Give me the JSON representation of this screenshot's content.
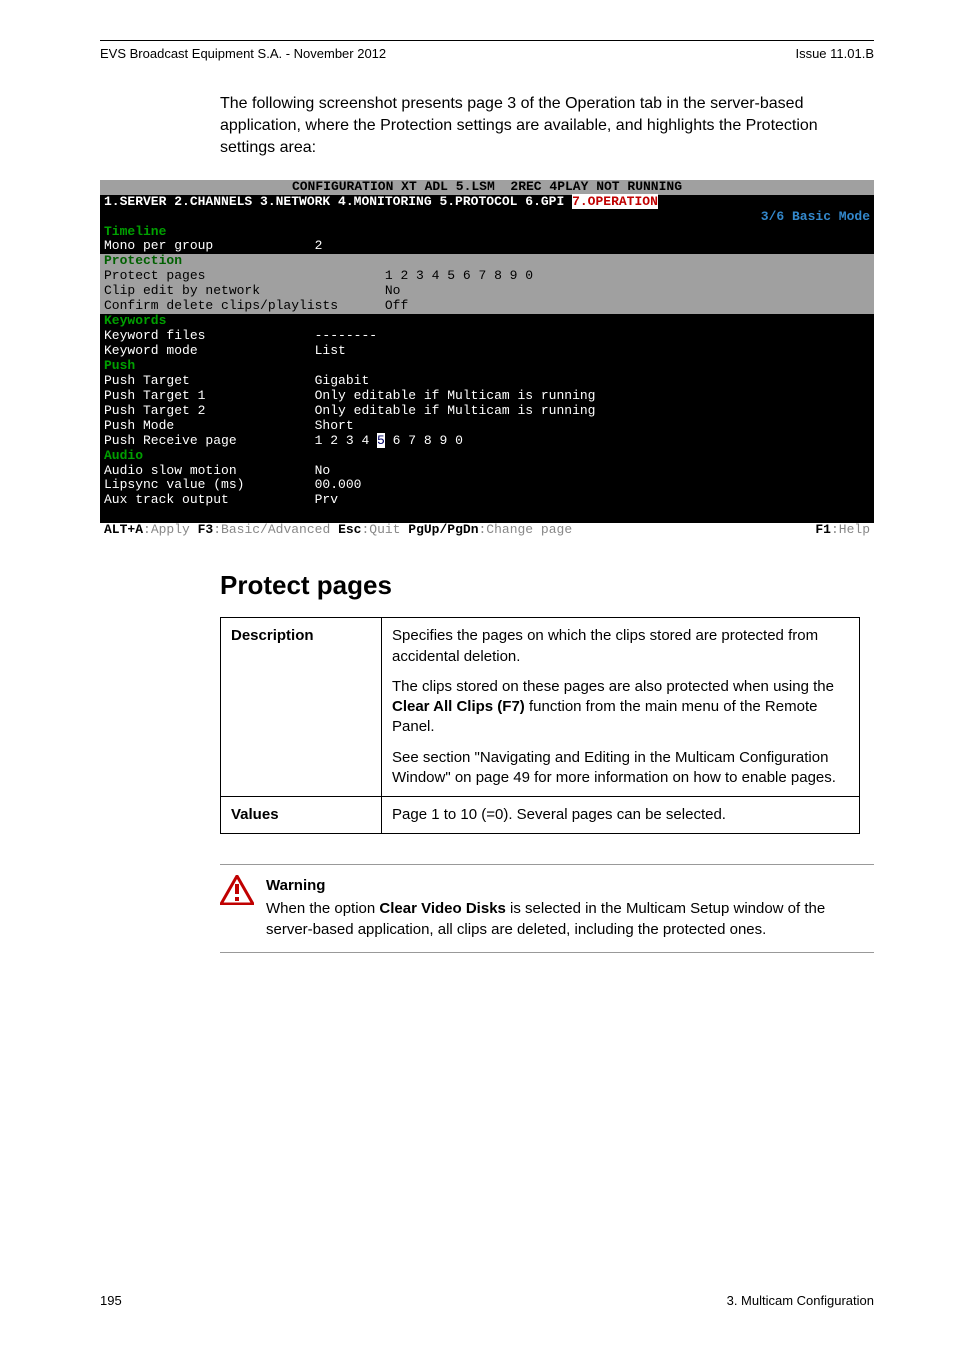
{
  "header": {
    "left": "EVS Broadcast Equipment S.A. - November 2012",
    "right": "Issue 11.01.B"
  },
  "intro": "The following screenshot presents page 3 of the Operation tab in the server-based application, where the Protection settings are available, and highlights the Protection settings area:",
  "terminal": {
    "title": "CONFIGURATION XT ADL 5.LSM  2REC 4PLAY NOT RUNNING",
    "tabs": "1.SERVER 2.CHANNELS 3.NETWORK 4.MONITORING 5.PROTOCOL 6.GPI ",
    "tabs_active": "7.OPERATION",
    "mode": "3/6 Basic Mode",
    "lines": {
      "timeline_h": "Timeline",
      "mono": "Mono per group             2",
      "protection_h": "Protection",
      "protect": "Protect pages                       1 2 3 4 5 6 7 8 9 0",
      "clipedit": "Clip edit by network                No",
      "confirm": "Confirm delete clips/playlists      Off",
      "keywords_h": "Keywords",
      "kfiles": "Keyword files              --------",
      "kmode": "Keyword mode               List",
      "push_h": "Push",
      "ptarget": "Push Target                Gigabit",
      "pt1": "Push Target 1              Only editable if Multicam is running",
      "pt2": "Push Target 2              Only editable if Multicam is running",
      "pmode": "Push Mode                  Short",
      "prcv_a": "Push Receive page          1 2 3 4 ",
      "prcv_hl": "5",
      "prcv_b": " 6 7 8 9 0",
      "audio_h": "Audio",
      "aslow": "Audio slow motion          No",
      "lips": "Lipsync value (ms)         00.000",
      "aux": "Aux track output           Prv"
    },
    "footer": {
      "a": "ALT+A",
      "at": ":Apply ",
      "b": "F3",
      "bt": ":Basic/Advanced ",
      "c": "Esc",
      "ct": ":Quit ",
      "d": "PgUp/PgDn",
      "dt": ":Change page",
      "e": "F1",
      "et": ":Help"
    }
  },
  "section_title": "Protect pages",
  "table": {
    "k1": "Description",
    "d1a": "Specifies the pages on which the clips stored are protected from accidental deletion.",
    "d1b_pre": "The clips stored on these pages are also protected when using the ",
    "d1b_bold": "Clear All Clips (F7)",
    "d1b_post": " function from the main menu of the Remote Panel.",
    "d1c": "See section \"Navigating and Editing in the Multicam Configuration Window\" on page 49 for more information on how to enable pages.",
    "k2": "Values",
    "d2": "Page 1 to 10 (=0). Several pages can be selected."
  },
  "warning": {
    "title": "Warning",
    "pre": "When the option ",
    "bold": "Clear Video Disks",
    "post": " is selected in the Multicam Setup window of the server-based application, all clips are deleted, including the protected ones."
  },
  "footer": {
    "left": "195",
    "right": "3. Multicam Configuration"
  }
}
